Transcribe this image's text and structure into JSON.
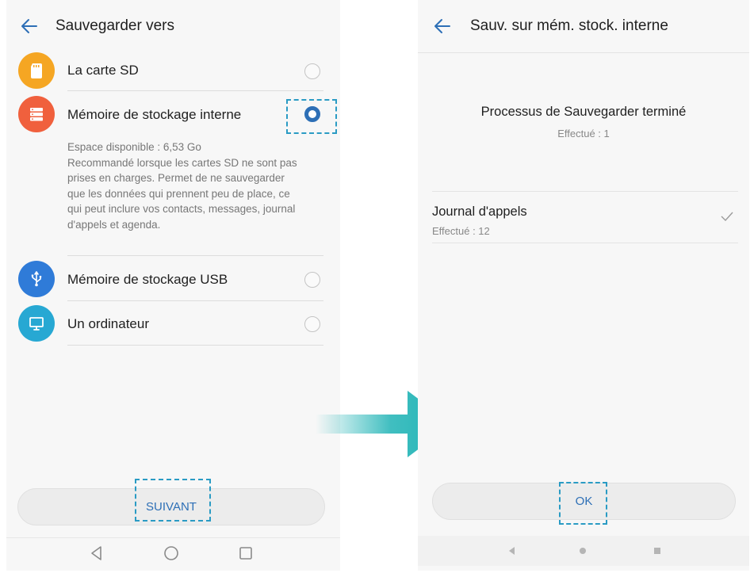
{
  "left_screen": {
    "title": "Sauvegarder vers",
    "options": [
      {
        "label": "La carte SD",
        "icon": "sd-card-icon",
        "color": "#f5a623",
        "selected": false
      },
      {
        "label": "Mémoire de stockage interne",
        "icon": "storage-icon",
        "color": "#f0603d",
        "selected": true
      },
      {
        "label": "Mémoire de stockage USB",
        "icon": "usb-icon",
        "color": "#2f7bd8",
        "selected": false
      },
      {
        "label": "Un ordinateur",
        "icon": "computer-icon",
        "color": "#27a8d3",
        "selected": false
      }
    ],
    "details": {
      "space": "Espace disponible : 6,53  Go",
      "description": "Recommandé lorsque les cartes SD ne sont pas prises en charges. Permet de ne sauvegarder que les données qui prennent peu de place, ce qui peut inclure vos contacts, messages, journal d'appels et agenda."
    },
    "next_button": "SUIVANT"
  },
  "right_screen": {
    "title": "Sauv. sur mém. stock. interne",
    "status_title": "Processus de Sauvegarder terminé",
    "status_sub": "Effectué : 1",
    "item": {
      "title": "Journal d'appels",
      "sub": "Effectué : 12",
      "icon": "check-icon"
    },
    "ok_button": "OK"
  },
  "colors": {
    "accent": "#2d6fb6",
    "highlight_dash": "#2a9bc4",
    "arrow": "#1fb3b5"
  }
}
